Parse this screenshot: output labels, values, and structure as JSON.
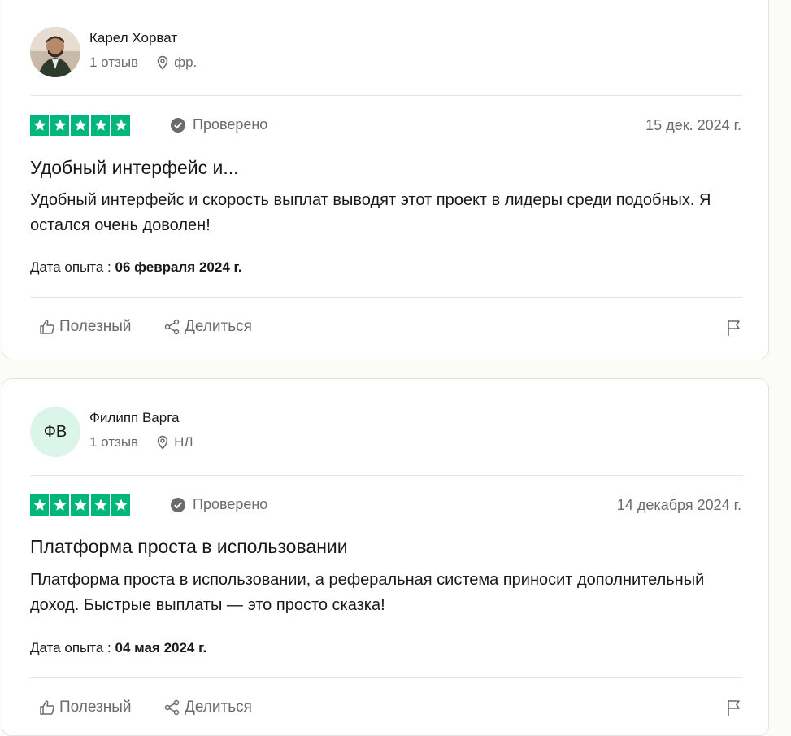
{
  "reviews": [
    {
      "reviewer_name": "Карел Хорват",
      "review_count": "1 отзыв",
      "country": "фр.",
      "avatar_initials": "",
      "rating": 5,
      "verified_label": "Проверено",
      "date": "15 дек. 2024 г.",
      "title": "Удобный интерфейс и...",
      "text": "Удобный интерфейс и скорость выплат выводят этот проект в лидеры среди подобных. Я остался очень доволен!",
      "experience_label": "Дата опыта :",
      "experience_date": "06 февраля 2024 г.",
      "useful_label": "Полезный",
      "share_label": "Делиться"
    },
    {
      "reviewer_name": "Филипп Варга",
      "review_count": "1 отзыв",
      "country": "НЛ",
      "avatar_initials": "ФВ",
      "rating": 5,
      "verified_label": "Проверено",
      "date": "14 декабря 2024 г.",
      "title": "Платформа проста в использовании",
      "text": "Платформа проста в использовании, а реферальная система приносит дополнительный доход. Быстрые выплаты — это просто сказка!",
      "experience_label": "Дата опыта :",
      "experience_date": "04 мая 2024 г.",
      "useful_label": "Полезный",
      "share_label": "Делиться"
    }
  ],
  "colors": {
    "star_green": "#00b67a",
    "muted_text": "#6b6b6b",
    "initials_bg": "#dcf5ea"
  },
  "icons": [
    "map-pin-icon",
    "verified-check-icon",
    "star-icon",
    "thumbs-up-icon",
    "share-icon",
    "flag-icon"
  ]
}
